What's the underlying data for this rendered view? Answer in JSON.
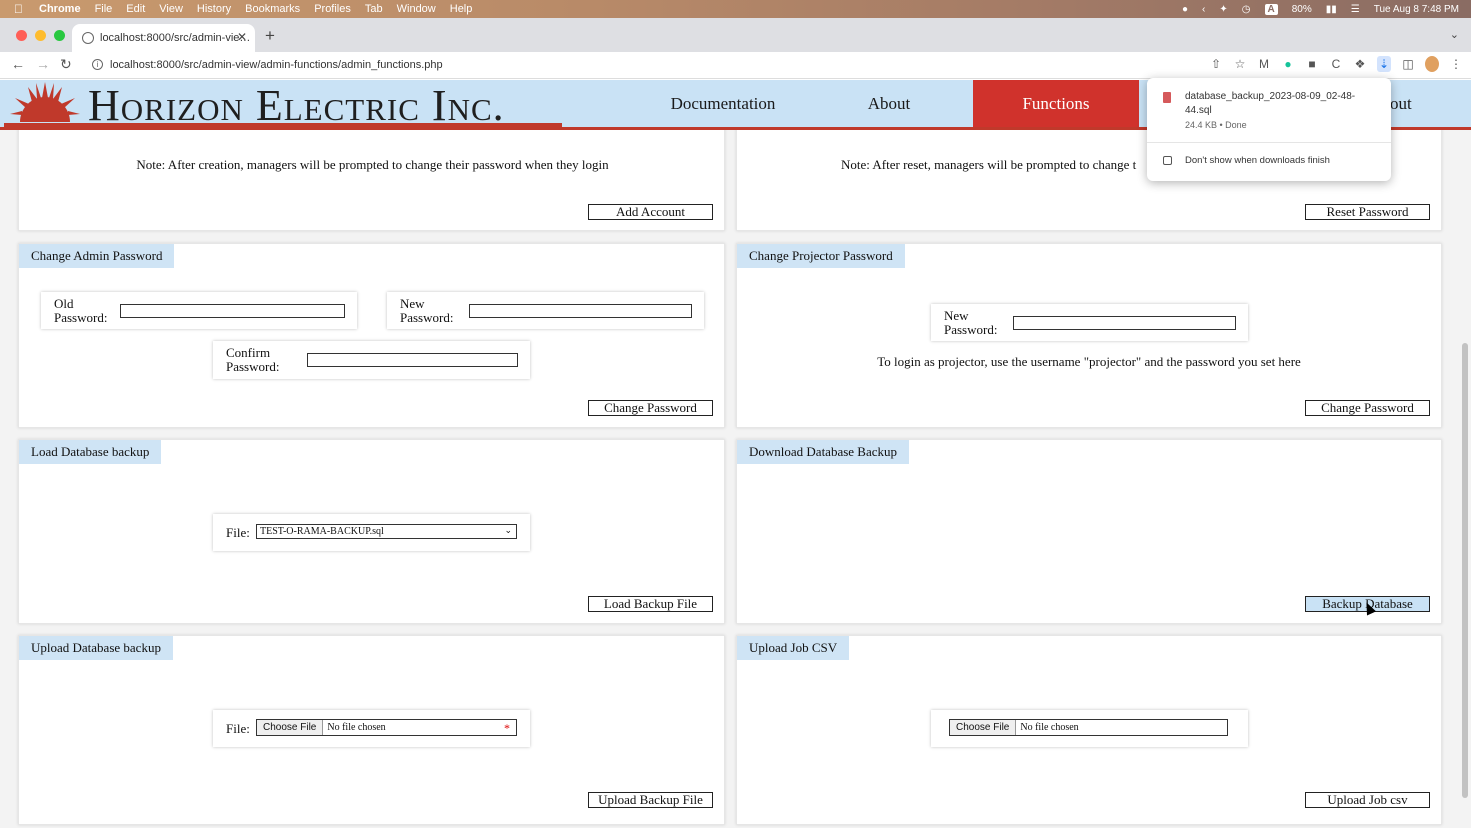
{
  "macbar": {
    "menus": [
      "Chrome",
      "File",
      "Edit",
      "View",
      "History",
      "Bookmarks",
      "Profiles",
      "Tab",
      "Window",
      "Help"
    ],
    "battery": "80%",
    "clock": "Tue Aug 8  7:48 PM"
  },
  "browser": {
    "tab_title": "localhost:8000/src/admin-vie…",
    "url": "localhost:8000/src/admin-view/admin-functions/admin_functions.php"
  },
  "site": {
    "brand": "Horizon Electric Inc.",
    "nav": [
      {
        "label": "Documentation"
      },
      {
        "label": "About"
      },
      {
        "label": "Functions",
        "active": true
      },
      {
        "label": "out"
      }
    ]
  },
  "download_popup": {
    "filename": "database_backup_2023-08-09_02-48-44.sql",
    "meta": "24.4 KB • Done",
    "checkbox_label": "Don't show when downloads finish"
  },
  "panels": {
    "add_account": {
      "note": "Note: After creation, managers will be prompted to change their password when they login",
      "button": "Add Account"
    },
    "reset_password": {
      "note": "Note: After reset, managers will be prompted to change t",
      "button": "Reset Password"
    },
    "change_admin": {
      "title": "Change Admin Password",
      "old_label_1": "Old",
      "old_label_2": "Password:",
      "new_label_1": "New",
      "new_label_2": "Password:",
      "confirm_label_1": "Confirm",
      "confirm_label_2": "Password:",
      "button": "Change Password"
    },
    "change_projector": {
      "title": "Change Projector Password",
      "new_label_1": "New",
      "new_label_2": "Password:",
      "note": "To login as projector, use the username \"projector\" and the password you set here",
      "button": "Change Password"
    },
    "load_backup": {
      "title": "Load Database backup",
      "file_label": "File:",
      "selected": "TEST-O-RAMA-BACKUP.sql",
      "button": "Load Backup File"
    },
    "download_backup": {
      "title": "Download Database Backup",
      "button": "Backup Database"
    },
    "upload_backup": {
      "title": "Upload Database backup",
      "file_label": "File:",
      "choose": "Choose File",
      "no_file": "No file chosen",
      "required": "*",
      "button": "Upload Backup File"
    },
    "upload_csv": {
      "title": "Upload Job CSV",
      "choose": "Choose File",
      "no_file": "No file chosen",
      "button": "Upload Job csv"
    }
  }
}
